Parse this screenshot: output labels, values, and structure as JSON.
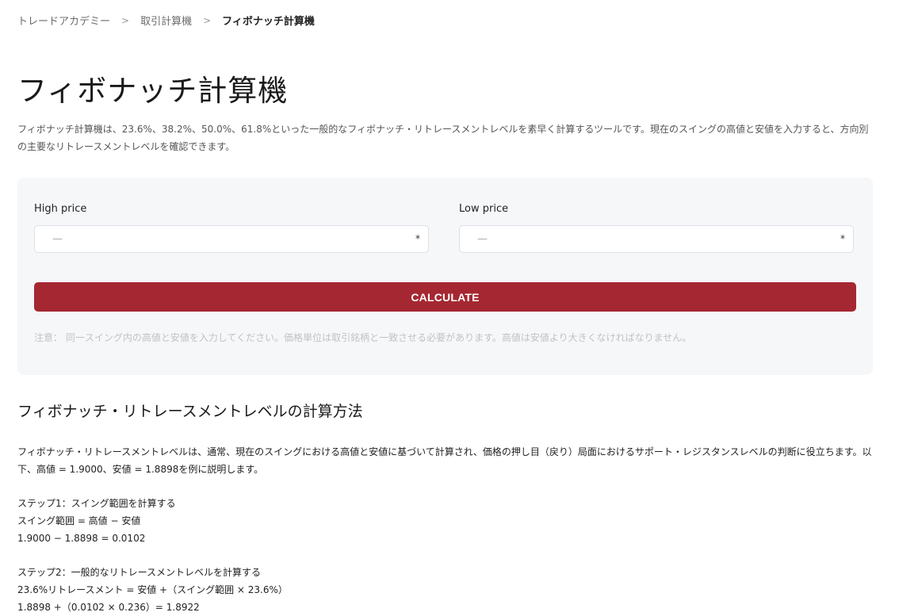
{
  "breadcrumb": {
    "items": [
      "トレードアカデミー",
      "取引計算機",
      "フィボナッチ計算機"
    ],
    "separator": ">"
  },
  "page": {
    "title": "フィボナッチ計算機",
    "intro": "フィボナッチ計算機は、23.6%、38.2%、50.0%、61.8%といった一般的なフィボナッチ・リトレースメントレベルを素早く計算するツールです。現在のスイングの高値と安値を入力すると、方向別の主要なリトレースメントレベルを確認できます。"
  },
  "calculator": {
    "high_label": "High price",
    "high_placeholder": "—",
    "low_label": "Low price",
    "low_placeholder": "—",
    "required_mark": "*",
    "button_label": "CALCULATE",
    "note": "注意： 同一スイング内の高値と安値を入力してください。価格単位は取引銘柄と一致させる必要があります。高値は安値より大きくなければなりません。"
  },
  "section": {
    "title": "フィボナッチ・リトレースメントレベルの計算方法",
    "intro": "フィボナッチ・リトレースメントレベルは、通常、現在のスイングにおける高値と安値に基づいて計算され、価格の押し目（戻り）局面におけるサポート・レジスタンスレベルの判断に役立ちます。以下、高値 = 1.9000、安値 = 1.8898を例に説明します。",
    "step1_title": "ステップ1：スイング範囲を計算する",
    "step1_formula": "スイング範囲 = 高値 − 安値",
    "step1_example": "1.9000 − 1.8898 = 0.0102",
    "step2_title": "ステップ2：一般的なリトレースメントレベルを計算する",
    "step2_formula": "23.6%リトレースメント = 安値 +（スイング範囲 × 23.6%）",
    "step2_example": "1.8898 +（0.0102 × 0.236）= 1.8922"
  },
  "colors": {
    "accent": "#a52731",
    "card_bg": "#f6f7f9",
    "note_text": "#c2c2c2"
  }
}
